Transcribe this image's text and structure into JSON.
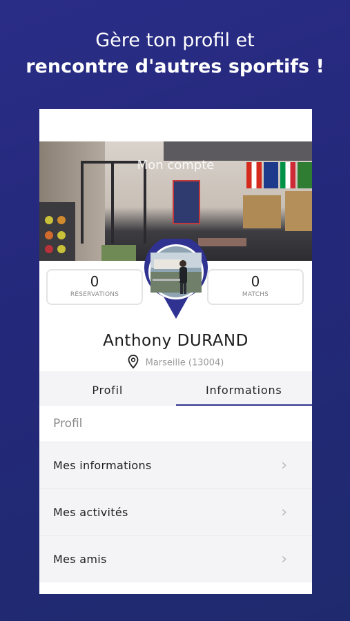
{
  "hero": {
    "line1": "Gère ton profil et",
    "line2": "rencontre d'autres sportifs !"
  },
  "banner": {
    "title": "Mon compte"
  },
  "stats": [
    {
      "value": "0",
      "label": "RÉSERVATIONS"
    },
    {
      "value": "0",
      "label": "MATCHS"
    }
  ],
  "profile": {
    "name": "Anthony DURAND",
    "location": "Marseille (13004)"
  },
  "tabs": [
    {
      "label": "Profil",
      "active": false
    },
    {
      "label": "Informations",
      "active": true
    }
  ],
  "section": {
    "title": "Profil"
  },
  "menu": [
    {
      "label": "Mes informations"
    },
    {
      "label": "Mes activités"
    },
    {
      "label": "Mes amis"
    }
  ],
  "colors": {
    "background": "#2a2d86",
    "accent": "#2f3290",
    "tab_underline": "#2f3290"
  },
  "icons": [
    "location-pin-icon",
    "chevron-right-icon"
  ]
}
